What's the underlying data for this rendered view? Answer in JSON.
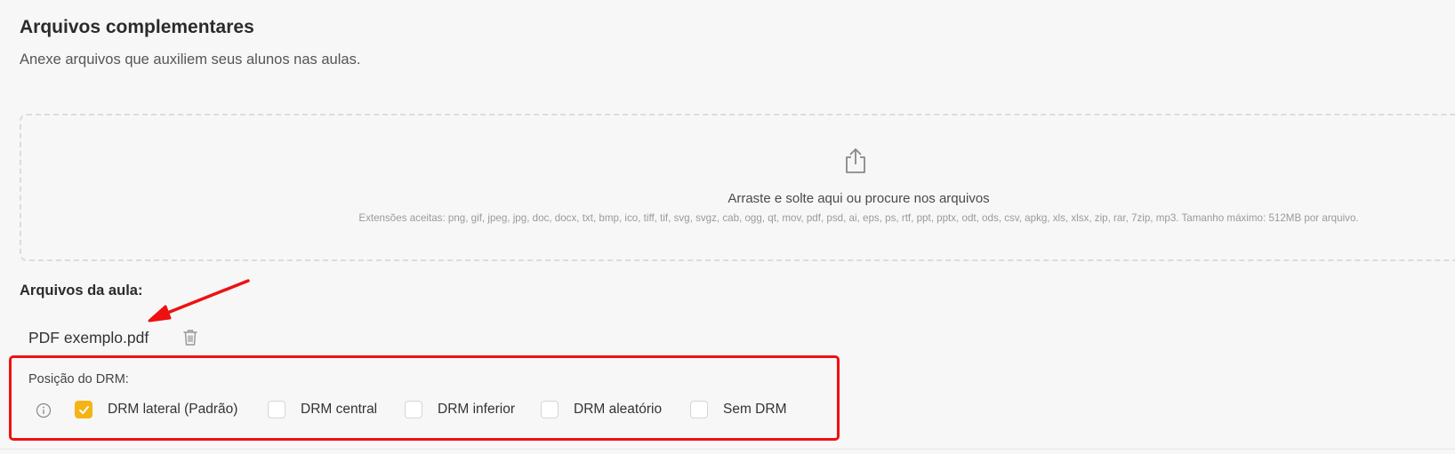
{
  "section": {
    "title": "Arquivos complementares",
    "subtitle": "Anexe arquivos que auxiliem seus alunos nas aulas."
  },
  "dropzone": {
    "icon": "upload-icon",
    "main_text": "Arraste e solte aqui ou procure nos arquivos",
    "extensions_text": "Extensões aceitas: png, gif, jpeg, jpg, doc, docx, txt, bmp, ico, tiff, tif, svg, svgz, cab, ogg, qt, mov, pdf, psd, ai, eps, ps, rtf, ppt, pptx, odt, ods, csv, apkg, xls, xlsx, zip, rar, 7zip, mp3. Tamanho máximo: 512MB por arquivo."
  },
  "files": {
    "heading": "Arquivos da aula:",
    "items": [
      {
        "name": "PDF exemplo.pdf",
        "action_icon": "trash-icon"
      }
    ]
  },
  "drm": {
    "label": "Posição do DRM:",
    "info_icon": "info-icon",
    "options": [
      {
        "label": "DRM lateral (Padrão)",
        "checked": true
      },
      {
        "label": "DRM central",
        "checked": false
      },
      {
        "label": "DRM inferior",
        "checked": false
      },
      {
        "label": "DRM aleatório",
        "checked": false
      },
      {
        "label": "Sem DRM",
        "checked": false
      }
    ]
  },
  "colors": {
    "accent": "#f5b416",
    "annotation": "#ee1111",
    "background": "#f7f7f7"
  }
}
